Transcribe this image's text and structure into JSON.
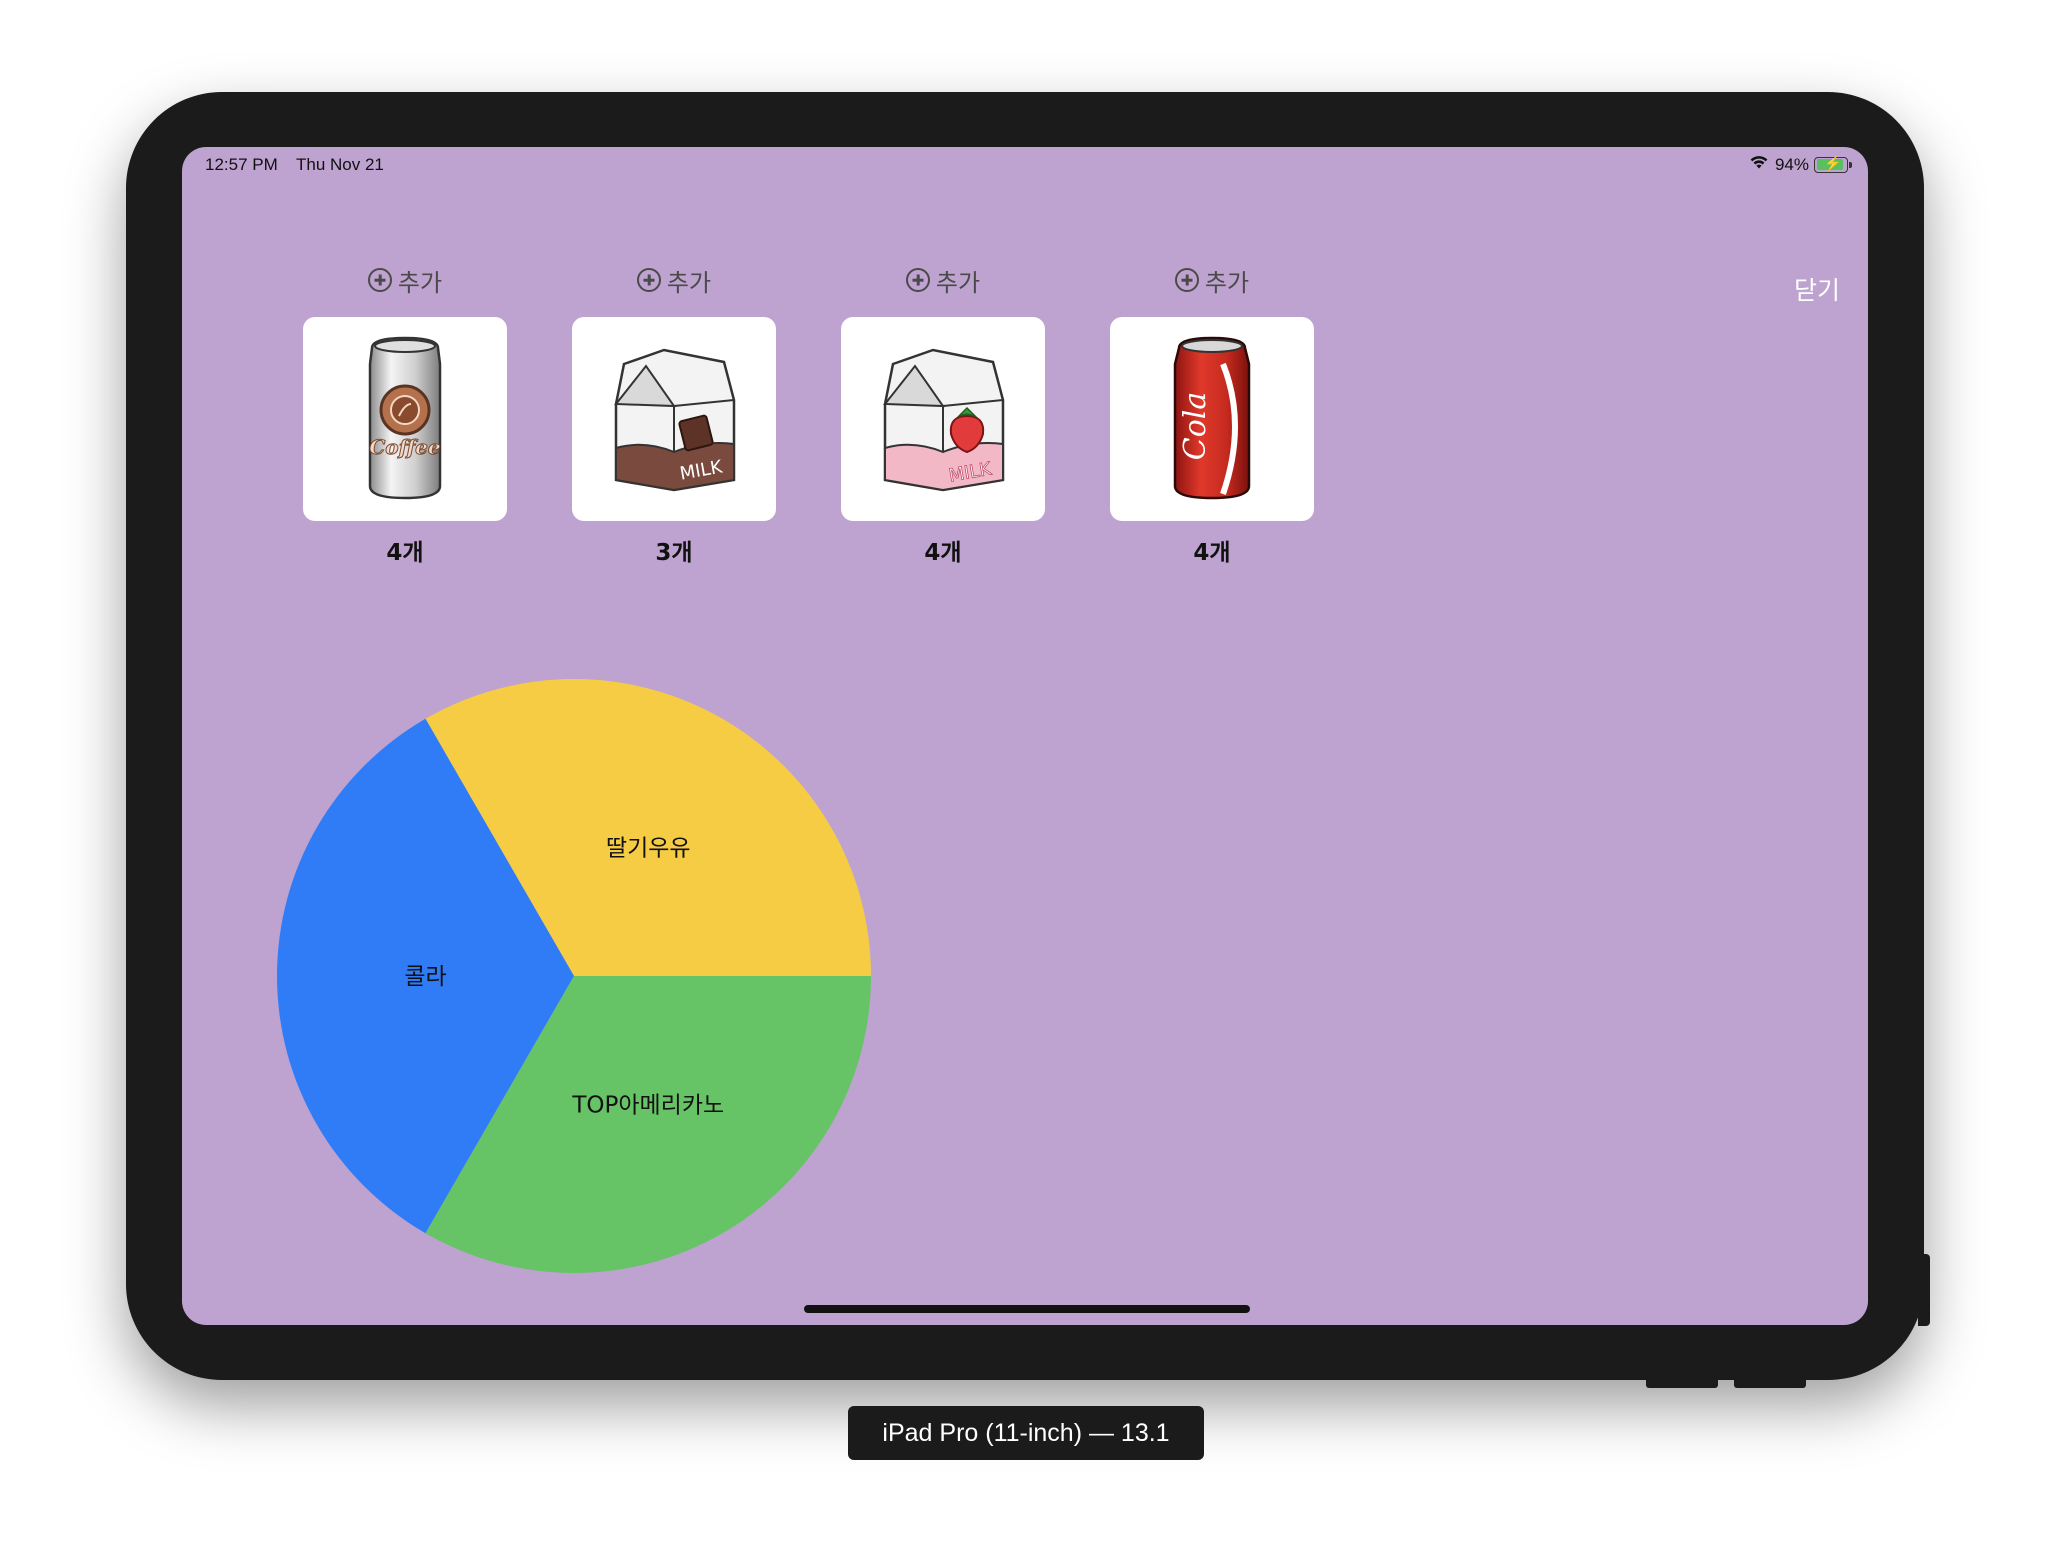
{
  "status_bar": {
    "time": "12:57 PM",
    "date": "Thu Nov 21",
    "battery": "94%",
    "battery_level": 0.94
  },
  "close_label": "닫기",
  "products": [
    {
      "add_label": "추가",
      "count": "4개",
      "image": "coffee-can-icon"
    },
    {
      "add_label": "추가",
      "count": "3개",
      "image": "chocolate-milk-carton-icon"
    },
    {
      "add_label": "추가",
      "count": "4개",
      "image": "strawberry-milk-carton-icon"
    },
    {
      "add_label": "추가",
      "count": "4개",
      "image": "cola-can-icon"
    }
  ],
  "chart_data": {
    "type": "pie",
    "slices": [
      {
        "label": "딸기우유",
        "value": 4,
        "color": "#f6cc45"
      },
      {
        "label": "콜라",
        "value": 4,
        "color": "#307cf6"
      },
      {
        "label": "TOP아메리카노",
        "value": 4,
        "color": "#66c466"
      }
    ]
  },
  "device_label": "iPad Pro (11-inch) — 13.1"
}
